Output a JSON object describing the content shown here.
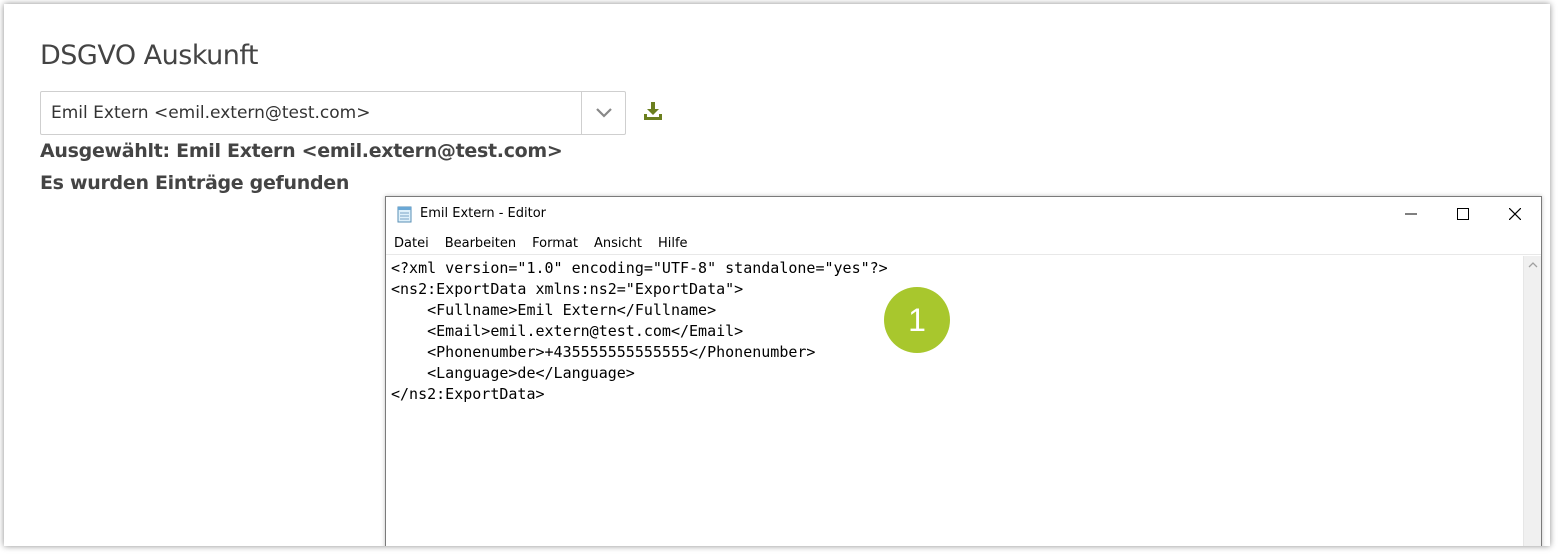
{
  "page": {
    "title": "DSGVO Auskunft",
    "selected_user": "Emil Extern <emil.extern@test.com>",
    "selected_text": "Ausgewählt: Emil Extern <emil.extern@test.com>",
    "status_text": "Es wurden Einträge gefunden",
    "download_icon": "download-icon",
    "accent_color": "#6b7f1e"
  },
  "editor": {
    "title": "Emil Extern - Editor",
    "menu": [
      "Datei",
      "Bearbeiten",
      "Format",
      "Ansicht",
      "Hilfe"
    ],
    "lines": [
      "<?xml version=\"1.0\" encoding=\"UTF-8\" standalone=\"yes\"?>",
      "<ns2:ExportData xmlns:ns2=\"ExportData\">",
      "    <Fullname>Emil Extern</Fullname>",
      "    <Email>emil.extern@test.com</Email>",
      "    <Phonenumber>+435555555555555</Phonenumber>",
      "    <Language>de</Language>",
      "</ns2:ExportData>"
    ]
  },
  "callout": {
    "label": "1",
    "color": "#a8c72d"
  }
}
